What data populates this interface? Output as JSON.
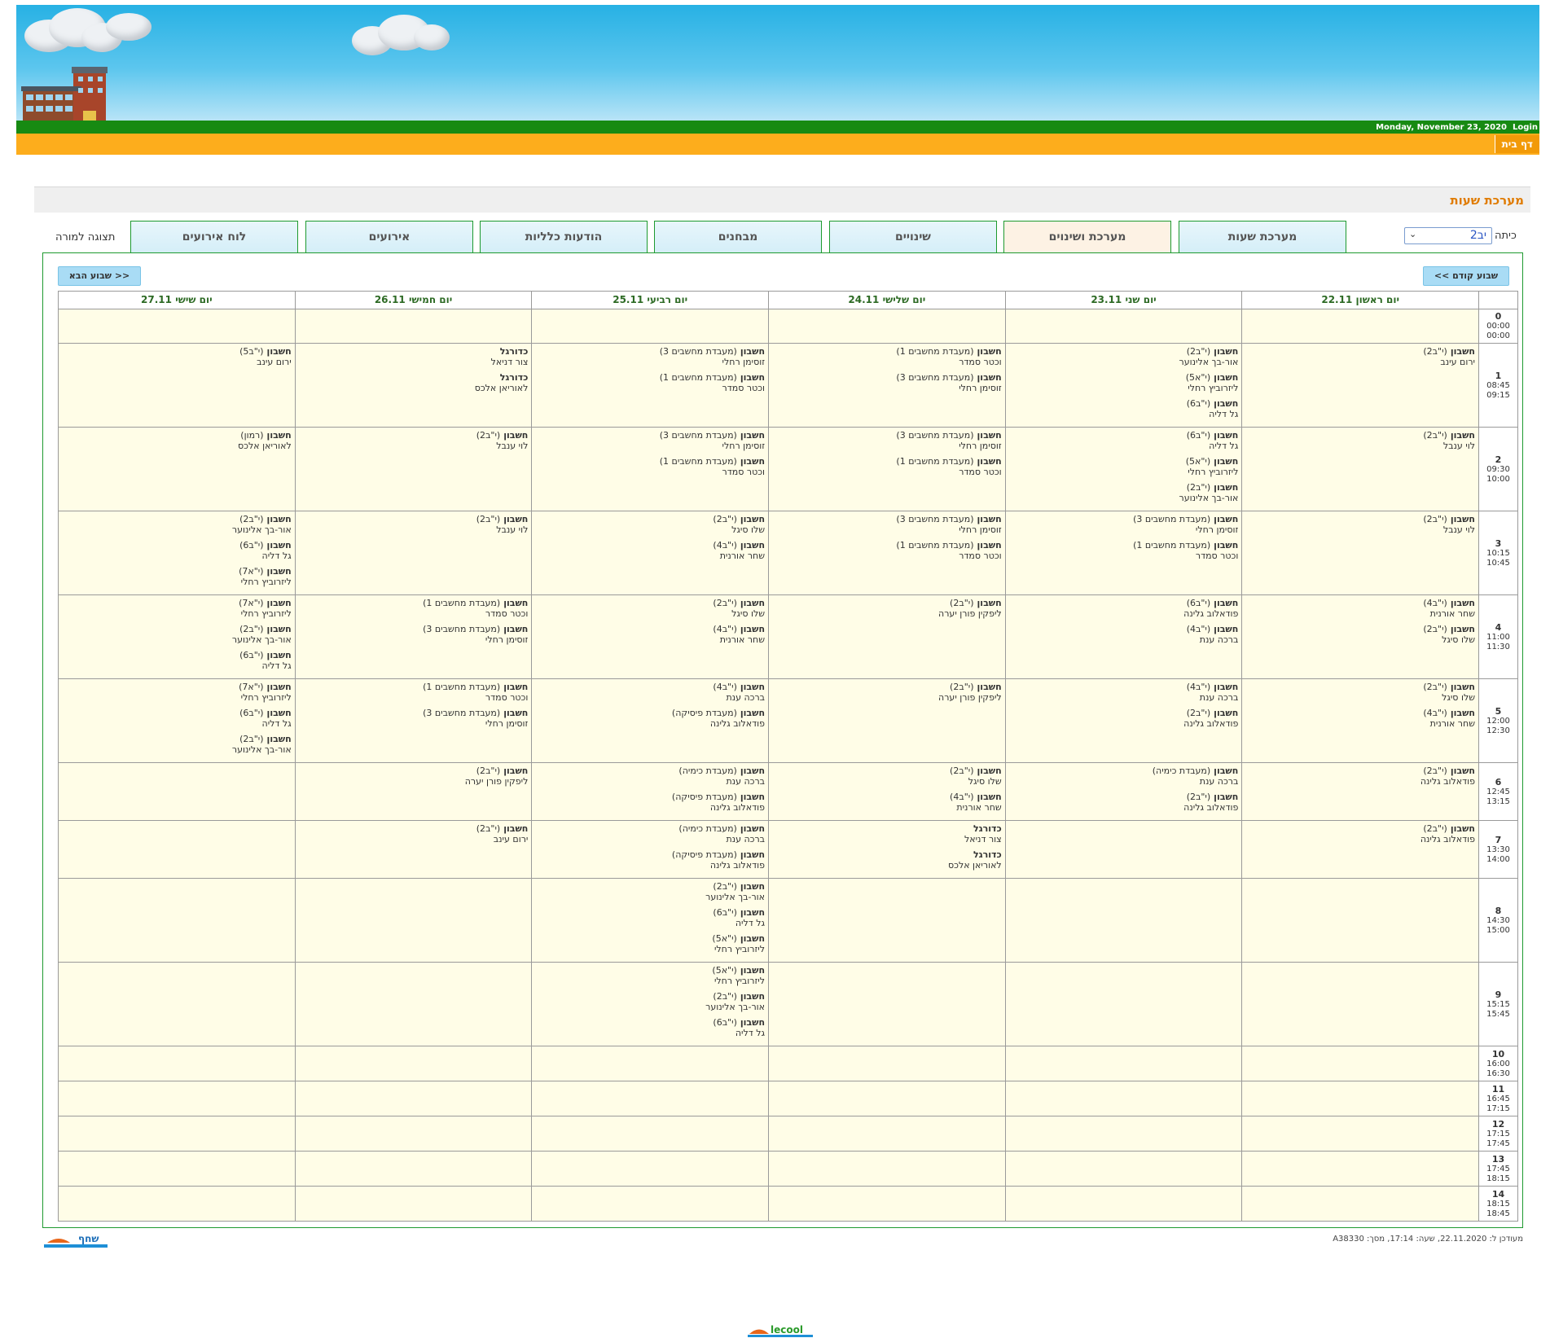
{
  "header": {
    "date": "Monday, November 23, 2020",
    "login_label": "Login",
    "home_label": "דף בית"
  },
  "page_title": "מערכת שעות",
  "class_selector": {
    "label": "כיתה",
    "value": "יב2"
  },
  "teacher_view_label": "תצוגה למורה",
  "tabs": [
    "מערכת שעות",
    "מערכת ושינוים",
    "שינויים",
    "מבחנים",
    "הודעות כלליות",
    "אירועים",
    "לוח אירועים"
  ],
  "active_tab_index": 1,
  "nav": {
    "prev_week": "<< שבוע קודם",
    "next_week": "שבוע הבא >>"
  },
  "days": [
    "יום ראשון 22.11",
    "יום שני 23.11",
    "יום שלישי 24.11",
    "יום רביעי 25.11",
    "יום חמישי 26.11",
    "יום שישי 27.11"
  ],
  "hours": [
    {
      "num": "0",
      "start": "00:00",
      "end": "00:00"
    },
    {
      "num": "1",
      "start": "08:45",
      "end": "09:15"
    },
    {
      "num": "2",
      "start": "09:30",
      "end": "10:00"
    },
    {
      "num": "3",
      "start": "10:15",
      "end": "10:45"
    },
    {
      "num": "4",
      "start": "11:00",
      "end": "11:30"
    },
    {
      "num": "5",
      "start": "12:00",
      "end": "12:30"
    },
    {
      "num": "6",
      "start": "12:45",
      "end": "13:15"
    },
    {
      "num": "7",
      "start": "13:30",
      "end": "14:00"
    },
    {
      "num": "8",
      "start": "14:30",
      "end": "15:00"
    },
    {
      "num": "9",
      "start": "15:15",
      "end": "15:45"
    },
    {
      "num": "10",
      "start": "16:00",
      "end": "16:30"
    },
    {
      "num": "11",
      "start": "16:45",
      "end": "17:15"
    },
    {
      "num": "12",
      "start": "17:15",
      "end": "17:45"
    },
    {
      "num": "13",
      "start": "17:45",
      "end": "18:15"
    },
    {
      "num": "14",
      "start": "18:15",
      "end": "18:45"
    }
  ],
  "schedule": [
    [
      [],
      [],
      [],
      [],
      [],
      []
    ],
    [
      [
        {
          "s": "חשבון",
          "c": "(י\"ב2)",
          "t": "ירום עינב"
        }
      ],
      [
        {
          "s": "חשבון",
          "c": "(י\"ב2)",
          "t": "אור-בך אלינוער"
        },
        {
          "s": "חשבון",
          "c": "(י\"א5)",
          "t": "ליזרוביץ רחלי"
        },
        {
          "s": "חשבון",
          "c": "(י\"ב6)",
          "t": "גל דליה"
        }
      ],
      [
        {
          "s": "חשבון",
          "c": "(מעבדת מחשבים 1)",
          "t": "וכטר סמדר"
        },
        {
          "s": "חשבון",
          "c": "(מעבדת מחשבים 3)",
          "t": "זוסימן רחלי"
        }
      ],
      [
        {
          "s": "חשבון",
          "c": "(מעבדת מחשבים 3)",
          "t": "זוסימן רחלי"
        },
        {
          "s": "חשבון",
          "c": "(מעבדת מחשבים 1)",
          "t": "וכטר סמדר"
        }
      ],
      [
        {
          "s": "כדורגל",
          "c": "",
          "t": "צור דניאל"
        },
        {
          "s": "כדורגל",
          "c": "",
          "t": "לאוריאן אלכס"
        }
      ],
      [
        {
          "s": "חשבון",
          "c": "(י\"ב5)",
          "t": "ירום עינב"
        }
      ]
    ],
    [
      [
        {
          "s": "חשבון",
          "c": "(י\"ב2)",
          "t": "לוי ענבל"
        }
      ],
      [
        {
          "s": "חשבון",
          "c": "(י\"ב6)",
          "t": "גל דליה"
        },
        {
          "s": "חשבון",
          "c": "(י\"א5)",
          "t": "ליזרוביץ רחלי"
        },
        {
          "s": "חשבון",
          "c": "(י\"ב2)",
          "t": "אור-בך אלינוער"
        }
      ],
      [
        {
          "s": "חשבון",
          "c": "(מעבדת מחשבים 3)",
          "t": "זוסימן רחלי"
        },
        {
          "s": "חשבון",
          "c": "(מעבדת מחשבים 1)",
          "t": "וכטר סמדר"
        }
      ],
      [
        {
          "s": "חשבון",
          "c": "(מעבדת מחשבים 3)",
          "t": "זוסימן רחלי"
        },
        {
          "s": "חשבון",
          "c": "(מעבדת מחשבים 1)",
          "t": "וכטר סמדר"
        }
      ],
      [
        {
          "s": "חשבון",
          "c": "(י\"ב2)",
          "t": "לוי ענבל"
        }
      ],
      [
        {
          "s": "חשבון",
          "c": "(רמון)",
          "t": "לאוריאן אלכס"
        }
      ]
    ],
    [
      [
        {
          "s": "חשבון",
          "c": "(י\"ב2)",
          "t": "לוי ענבל"
        }
      ],
      [
        {
          "s": "חשבון",
          "c": "(מעבדת מחשבים 3)",
          "t": "זוסימן רחלי"
        },
        {
          "s": "חשבון",
          "c": "(מעבדת מחשבים 1)",
          "t": "וכטר סמדר"
        }
      ],
      [
        {
          "s": "חשבון",
          "c": "(מעבדת מחשבים 3)",
          "t": "זוסימן רחלי"
        },
        {
          "s": "חשבון",
          "c": "(מעבדת מחשבים 1)",
          "t": "וכטר סמדר"
        }
      ],
      [
        {
          "s": "חשבון",
          "c": "(י\"ב2)",
          "t": "שלו סיגל"
        },
        {
          "s": "חשבון",
          "c": "(י\"ב4)",
          "t": "שחר אורנית"
        }
      ],
      [
        {
          "s": "חשבון",
          "c": "(י\"ב2)",
          "t": "לוי ענבל"
        }
      ],
      [
        {
          "s": "חשבון",
          "c": "(י\"ב2)",
          "t": "אור-בך אלינוער"
        },
        {
          "s": "חשבון",
          "c": "(י\"ב6)",
          "t": "גל דליה"
        },
        {
          "s": "חשבון",
          "c": "(י\"א7)",
          "t": "ליזרוביץ רחלי"
        }
      ]
    ],
    [
      [
        {
          "s": "חשבון",
          "c": "(י\"ב4)",
          "t": "שחר אורנית"
        },
        {
          "s": "חשבון",
          "c": "(י\"ב2)",
          "t": "שלו סיגל"
        }
      ],
      [
        {
          "s": "חשבון",
          "c": "(י\"ב6)",
          "t": "פודאלוב גלינה"
        },
        {
          "s": "חשבון",
          "c": "(י\"ב4)",
          "t": "ברכה ענת"
        }
      ],
      [
        {
          "s": "חשבון",
          "c": "(י\"ב2)",
          "t": "ליפקין פורן יערה"
        }
      ],
      [
        {
          "s": "חשבון",
          "c": "(י\"ב2)",
          "t": "שלו סיגל"
        },
        {
          "s": "חשבון",
          "c": "(י\"ב4)",
          "t": "שחר אורנית"
        }
      ],
      [
        {
          "s": "חשבון",
          "c": "(מעבדת מחשבים 1)",
          "t": "וכטר סמדר"
        },
        {
          "s": "חשבון",
          "c": "(מעבדת מחשבים 3)",
          "t": "זוסימן רחלי"
        }
      ],
      [
        {
          "s": "חשבון",
          "c": "(י\"א7)",
          "t": "ליזרוביץ רחלי"
        },
        {
          "s": "חשבון",
          "c": "(י\"ב2)",
          "t": "אור-בך אלינוער"
        },
        {
          "s": "חשבון",
          "c": "(י\"ב6)",
          "t": "גל דליה"
        }
      ]
    ],
    [
      [
        {
          "s": "חשבון",
          "c": "(י\"ב2)",
          "t": "שלו סיגל"
        },
        {
          "s": "חשבון",
          "c": "(י\"ב4)",
          "t": "שחר אורנית"
        }
      ],
      [
        {
          "s": "חשבון",
          "c": "(י\"ב4)",
          "t": "ברכה ענת"
        },
        {
          "s": "חשבון",
          "c": "(י\"ב2)",
          "t": "פודאלוב גלינה"
        }
      ],
      [
        {
          "s": "חשבון",
          "c": "(י\"ב2)",
          "t": "ליפקין פורן יערה"
        }
      ],
      [
        {
          "s": "חשבון",
          "c": "(י\"ב4)",
          "t": "ברכה ענת"
        },
        {
          "s": "חשבון",
          "c": "(מעבדת פיסיקה)",
          "t": "פודאלוב גלינה"
        }
      ],
      [
        {
          "s": "חשבון",
          "c": "(מעבדת מחשבים 1)",
          "t": "וכטר סמדר"
        },
        {
          "s": "חשבון",
          "c": "(מעבדת מחשבים 3)",
          "t": "זוסימן רחלי"
        }
      ],
      [
        {
          "s": "חשבון",
          "c": "(י\"א7)",
          "t": "ליזרוביץ רחלי"
        },
        {
          "s": "חשבון",
          "c": "(י\"ב6)",
          "t": "גל דליה"
        },
        {
          "s": "חשבון",
          "c": "(י\"ב2)",
          "t": "אור-בך אלינוער"
        }
      ]
    ],
    [
      [
        {
          "s": "חשבון",
          "c": "(י\"ב2)",
          "t": "פודאלוב גלינה"
        }
      ],
      [
        {
          "s": "חשבון",
          "c": "(מעבדת כימיה)",
          "t": "ברכה ענת"
        },
        {
          "s": "חשבון",
          "c": "(י\"ב2)",
          "t": "פודאלוב גלינה"
        }
      ],
      [
        {
          "s": "חשבון",
          "c": "(י\"ב2)",
          "t": "שלו סיגל"
        },
        {
          "s": "חשבון",
          "c": "(י\"ב4)",
          "t": "שחר אורנית"
        }
      ],
      [
        {
          "s": "חשבון",
          "c": "(מעבדת כימיה)",
          "t": "ברכה ענת"
        },
        {
          "s": "חשבון",
          "c": "(מעבדת פיסיקה)",
          "t": "פודאלוב גלינה"
        }
      ],
      [
        {
          "s": "חשבון",
          "c": "(י\"ב2)",
          "t": "ליפקין פורן יערה"
        }
      ],
      []
    ],
    [
      [
        {
          "s": "חשבון",
          "c": "(י\"ב2)",
          "t": "פודאלוב גלינה"
        }
      ],
      [],
      [
        {
          "s": "כדורגל",
          "c": "",
          "t": "צור דניאל"
        },
        {
          "s": "כדורגל",
          "c": "",
          "t": "לאוריאן אלכס"
        }
      ],
      [
        {
          "s": "חשבון",
          "c": "(מעבדת כימיה)",
          "t": "ברכה ענת"
        },
        {
          "s": "חשבון",
          "c": "(מעבדת פיסיקה)",
          "t": "פודאלוב גלינה"
        }
      ],
      [
        {
          "s": "חשבון",
          "c": "(י\"ב2)",
          "t": "ירום עינב"
        }
      ],
      []
    ],
    [
      [],
      [],
      [],
      [
        {
          "s": "חשבון",
          "c": "(י\"ב2)",
          "t": "אור-בך אלינוער"
        },
        {
          "s": "חשבון",
          "c": "(י\"ב6)",
          "t": "גל דליה"
        },
        {
          "s": "חשבון",
          "c": "(י\"א5)",
          "t": "ליזרוביץ רחלי"
        }
      ],
      [],
      []
    ],
    [
      [],
      [],
      [],
      [
        {
          "s": "חשבון",
          "c": "(י\"א5)",
          "t": "ליזרוביץ רחלי"
        },
        {
          "s": "חשבון",
          "c": "(י\"ב2)",
          "t": "אור-בך אלינוער"
        },
        {
          "s": "חשבון",
          "c": "(י\"ב6)",
          "t": "גל דליה"
        }
      ],
      [],
      []
    ],
    [
      [],
      [],
      [],
      [],
      [],
      []
    ],
    [
      [],
      [],
      [],
      [],
      [],
      []
    ],
    [
      [],
      [],
      [],
      [],
      [],
      []
    ],
    [
      [],
      [],
      [],
      [],
      [],
      []
    ],
    [
      [],
      [],
      [],
      [],
      [],
      []
    ]
  ],
  "footer": {
    "updated_text": "מעודכן ל: 22.11.2020, שעה: 17:14, מסך: A38330",
    "shahaf_logo": "שחף",
    "lecool_logo": "lecool"
  },
  "colors": {
    "accent_orange": "#fdad1c",
    "accent_green": "#1e9a2f",
    "title_orange": "#e07b00",
    "cell_bg": "#fffde7"
  }
}
